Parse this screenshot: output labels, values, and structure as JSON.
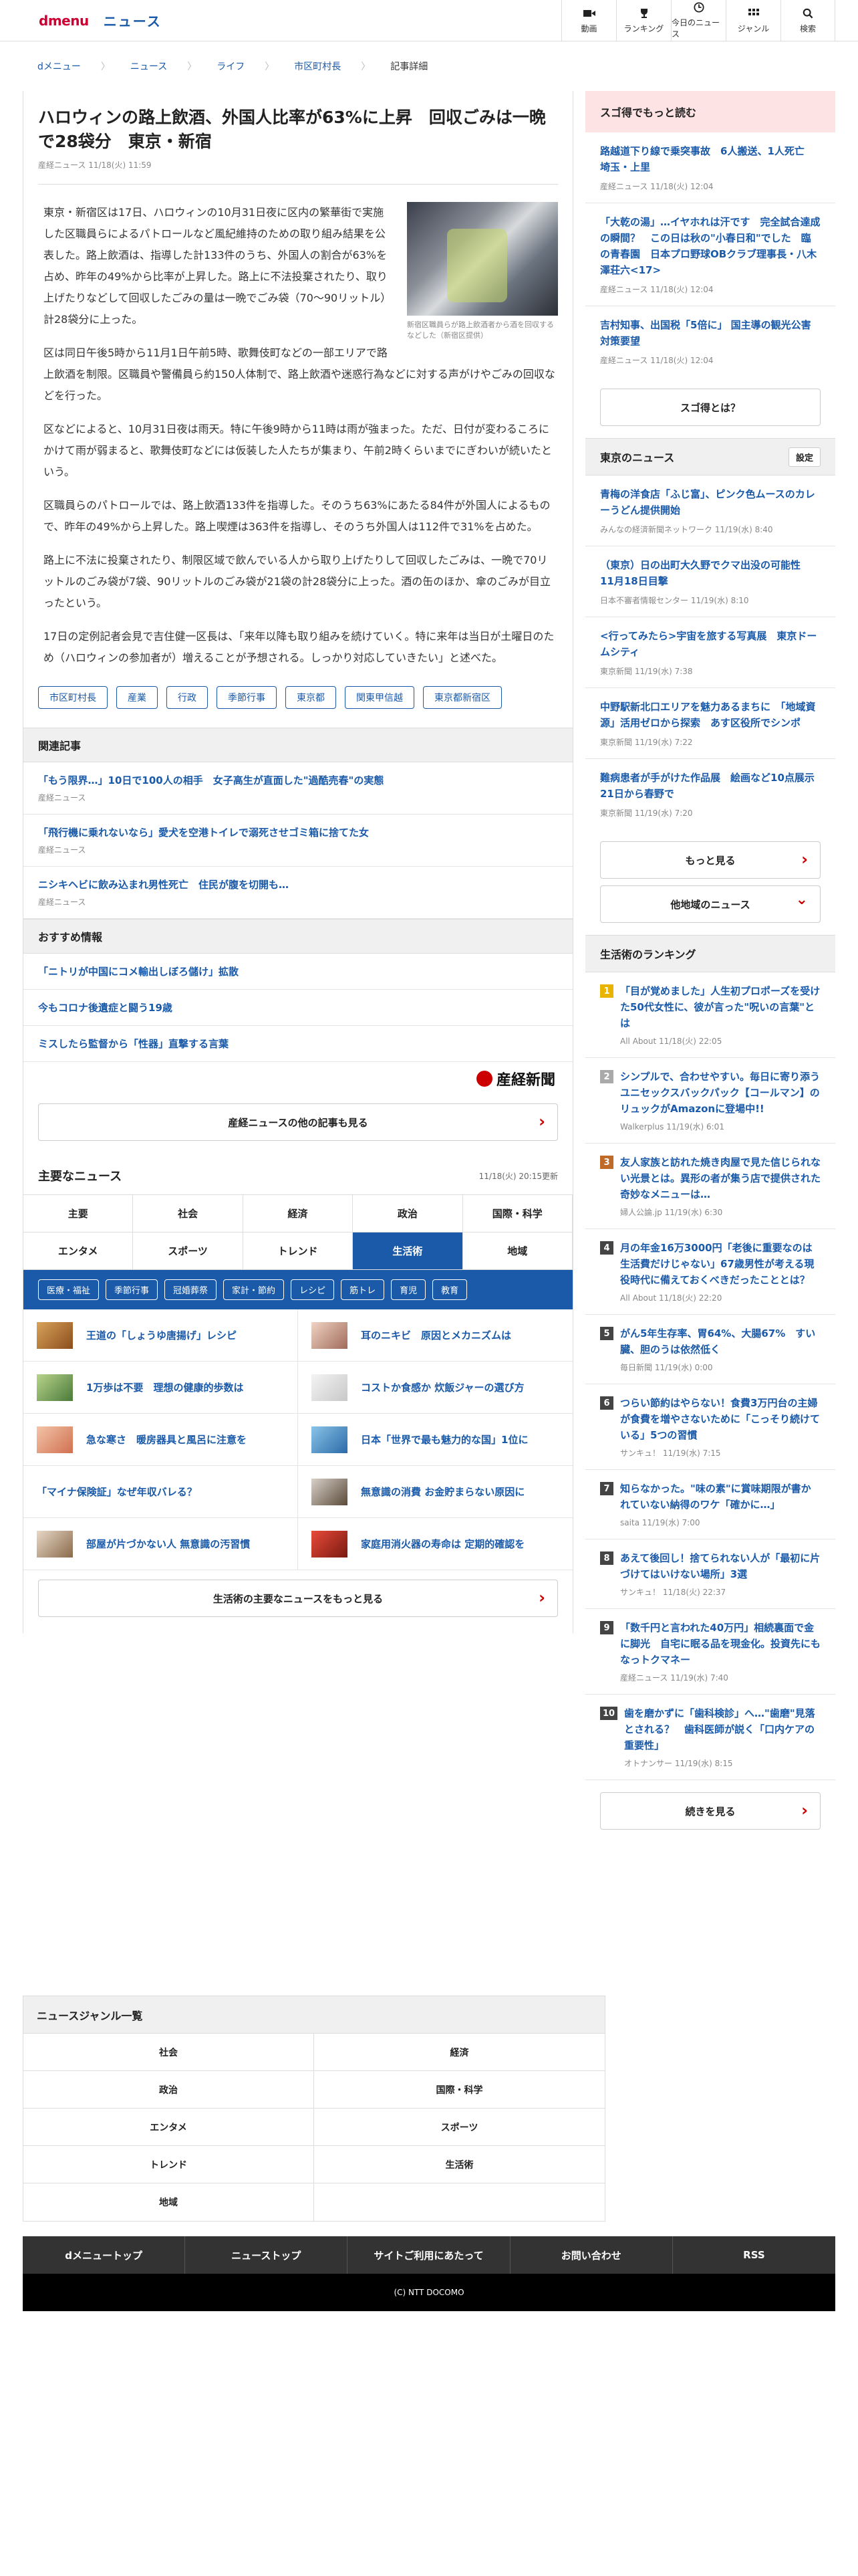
{
  "header": {
    "logo": "dmenu",
    "section": "ニュース",
    "nav": [
      {
        "label": "動画",
        "icon": "video-icon"
      },
      {
        "label": "ランキング",
        "icon": "trophy-icon"
      },
      {
        "label": "今日のニュース",
        "icon": "clock-icon"
      },
      {
        "label": "ジャンル",
        "icon": "grid-icon"
      },
      {
        "label": "検索",
        "icon": "search-icon"
      }
    ]
  },
  "breadcrumb": [
    "dメニュー",
    "ニュース",
    "ライフ",
    "市区町村長",
    "記事詳細"
  ],
  "article": {
    "title": "ハロウィンの路上飲酒、外国人比率が63%に上昇　回収ごみは一晩で28袋分　東京・新宿",
    "meta": "産経ニュース 11/18(火) 11:59",
    "photo_caption": "新宿区職員らが路上飲酒者から酒を回収するなどした（新宿区提供）",
    "paragraphs": [
      "東京・新宿区は17日、ハロウィンの10月31日夜に区内の繁華街で実施した区職員らによるパトロールなど風紀維持のための取り組み結果を公表した。路上飲酒は、指導した計133件のうち、外国人の割合が63%を占め、昨年の49%から比率が上昇した。路上に不法投棄されたり、取り上げたりなどして回収したごみの量は一晩でごみ袋（70～90リットル）計28袋分に上った。",
      "区は同日午後5時から11月1日午前5時、歌舞伎町などの一部エリアで路上飲酒を制限。区職員や警備員ら約150人体制で、路上飲酒や迷惑行為などに対する声がけやごみの回収などを行った。",
      "区などによると、10月31日夜は雨天。特に午後9時から11時は雨が強まった。ただ、日付が変わるころにかけて雨が弱まると、歌舞伎町などには仮装した人たちが集まり、午前2時くらいまでにぎわいが続いたという。",
      "区職員らのパトロールでは、路上飲酒133件を指導した。そのうち63%にあたる84件が外国人によるもので、昨年の49%から上昇した。路上喫煙は363件を指導し、そのうち外国人は112件で31%を占めた。",
      "路上に不法に投棄されたり、制限区域で飲んでいる人から取り上げたりして回収したごみは、一晩で70リットルのごみ袋が7袋、90リットルのごみ袋が21袋の計28袋分に上った。酒の缶のほか、傘のごみが目立ったという。",
      "17日の定例記者会見で吉住健一区長は、「来年以降も取り組みを続けていく。特に来年は当日が土曜日のため（ハロウィンの参加者が）増えることが予想される。しっかり対応していきたい」と述べた。"
    ],
    "tags": [
      "市区町村長",
      "産業",
      "行政",
      "季節行事",
      "東京都",
      "関東甲信越",
      "東京都新宿区"
    ]
  },
  "related": {
    "heading": "関連記事",
    "items": [
      {
        "title": "「もう限界…」10日で100人の相手　女子高生が直面した\"過酷売春\"の実態",
        "source": "産経ニュース"
      },
      {
        "title": "「飛行機に乗れないなら」愛犬を空港トイレで溺死させゴミ箱に捨てた女",
        "source": "産経ニュース"
      },
      {
        "title": "ニシキヘビに飲み込まれ男性死亡　住民が腹を切開も…",
        "source": "産経ニュース"
      }
    ]
  },
  "recommend": {
    "heading": "おすすめ情報",
    "items": [
      "「ニトリが中国にコメ輸出しぼろ儲け」拡散",
      "今もコロナ後遺症と闘う19歳",
      "ミスしたら監督から「性器」直撃する言葉"
    ]
  },
  "publisher": "産経新聞",
  "more_publisher": "産経ニュースの他の記事も見る",
  "main_news": {
    "heading": "主要なニュース",
    "updated": "11/18(火) 20:15更新",
    "tabs": [
      "主要",
      "社会",
      "経済",
      "政治",
      "国際・科学",
      "エンタメ",
      "スポーツ",
      "トレンド",
      "生活術",
      "地域"
    ],
    "active_tab": "生活術",
    "subtabs": [
      "医療・福祉",
      "季節行事",
      "冠婚葬祭",
      "家計・節約",
      "レシピ",
      "筋トレ",
      "育児",
      "教育"
    ],
    "items": [
      "王道の「しょうゆ唐揚げ」レシピ",
      "耳のニキビ　原因とメカニズムは",
      "1万歩は不要　理想の健康的歩数は",
      "コストか食感か 炊飯ジャーの選び方",
      "急な寒さ　暖房器具と風呂に注意を",
      "日本「世界で最も魅力的な国」1位に",
      "「マイナ保険証」なぜ年収バレる？",
      "無意識の消費 お金貯まらない原因に",
      "部屋が片づかない人 無意識の汚習慣",
      "家庭用消火器の寿命は 定期的確認を"
    ],
    "more": "生活術の主要なニュースをもっと見る"
  },
  "sidebar": {
    "pickup_heading": "スゴ得でもっと読む",
    "pickup": [
      {
        "title": "路越道下り線で乗突事故　6人搬送、1人死亡　埼玉・上里",
        "meta": "産経ニュース 11/18(火) 12:04"
      },
      {
        "title": "「大乾の湯」…イヤホれは汗です　完全試合達成の瞬間？　この日は秋の\"小春日和\"でした　臨の青春園　日本プロ野球OBクラブ理事長・八木澤荘六<17>",
        "meta": "産経ニュース 11/18(火) 12:04"
      },
      {
        "title": "吉村知事、出国税「5倍に」 国主導の観光公害対策要望",
        "meta": "産経ニュース 11/18(火) 12:04"
      }
    ],
    "pickup_button": "スゴ得とは？",
    "tokyo_heading": "東京のニュース",
    "tokyo_setting": "設定",
    "tokyo": [
      {
        "title": "青梅の洋食店「ふじ富」、ピンク色ムースのカレーうどん提供開始",
        "meta": "みんなの経済新聞ネットワーク 11/19(水) 8:40"
      },
      {
        "title": "（東京）日の出町大久野でクマ出没の可能性　11月18日目撃",
        "meta": "日本不審者情報センター 11/19(水) 8:10"
      },
      {
        "title": "<行ってみたら>宇宙を旅する写真展　東京ドームシティ",
        "meta": "東京新聞 11/19(水) 7:38"
      },
      {
        "title": "中野駅新北口エリアを魅力あるまちに　「地域資源」活用ゼロから探索　あす区役所でシンポ",
        "meta": "東京新聞 11/19(水) 7:22"
      },
      {
        "title": "難病患者が手がけた作品展　絵画など10点展示　21日から春野で",
        "meta": "東京新聞 11/19(水) 7:20"
      }
    ],
    "more_button": "もっと見る",
    "region_button": "他地域のニュース",
    "rank_heading": "生活術のランキング",
    "ranking": [
      {
        "n": "1",
        "title": "「目が覚めました」人生初プロポーズを受けた50代女性に、彼が言った\"呪いの言葉\"とは",
        "meta": "All About 11/18(火) 22:05"
      },
      {
        "n": "2",
        "title": "シンプルで、合わせやすい。毎日に寄り添うユニセックスバックパック【コールマン】のリュックがAmazonに登場中!!",
        "meta": "Walkerplus 11/19(水) 6:01"
      },
      {
        "n": "3",
        "title": "友人家族と訪れた焼き肉屋で見た信じられない光景とは。異形の者が集う店で提供された奇妙なメニューは…",
        "meta": "婦人公論.jp 11/19(水) 6:30"
      },
      {
        "n": "4",
        "title": "月の年金16万3000円「老後に重要なのは生活費だけじゃない」67歳男性が考える現役時代に備えておくべきだったこととは？",
        "meta": "All About 11/18(火) 22:20"
      },
      {
        "n": "5",
        "title": "がん5年生存率、胃64%、大腸67%　すい臓、胆のうは依然低く",
        "meta": "毎日新聞 11/19(水) 0:00"
      },
      {
        "n": "6",
        "title": "つらい節約はやらない！食費3万円台の主婦が食費を増やさないために「こっそり続けている」5つの習慣",
        "meta": "サンキュ！ 11/19(水) 7:15"
      },
      {
        "n": "7",
        "title": "知らなかった。\"味の素\"に賞味期限が書かれていない納得のワケ「確かに…」",
        "meta": "saita 11/19(水) 7:00"
      },
      {
        "n": "8",
        "title": "あえて後回し！捨てられない人が「最初に片づけてはいけない場所」3選",
        "meta": "サンキュ！ 11/18(火) 22:37"
      },
      {
        "n": "9",
        "title": "「数千円と言われた40万円」相続裏面で金に脚光　自宅に眠る品を現金化。投資先にも　なっトクマネー",
        "meta": "産経ニュース 11/19(水) 7:40"
      },
      {
        "n": "10",
        "title": "歯を磨かずに「歯科検診」へ…\"歯磨\"見落とされる？　歯科医師が説く「口内ケアの重要性」",
        "meta": "オトナンサー 11/19(水) 8:15"
      }
    ],
    "rank_more": "続きを見る"
  },
  "genre_list": {
    "heading": "ニュースジャンル一覧",
    "items": [
      "社会",
      "経済",
      "政治",
      "国際・科学",
      "エンタメ",
      "スポーツ",
      "トレンド",
      "生活術",
      "地域"
    ]
  },
  "footer": {
    "links": [
      "dメニュートップ",
      "ニューストップ",
      "サイトご利用にあたって",
      "お問い合わせ",
      "RSS"
    ],
    "copyright": "(C) NTT DOCOMO"
  },
  "colors": {
    "brand": "#cc0033",
    "link": "#1a5aa8",
    "pickup_bg": "#fde3e3",
    "active_tab": "#1a5aa8"
  }
}
